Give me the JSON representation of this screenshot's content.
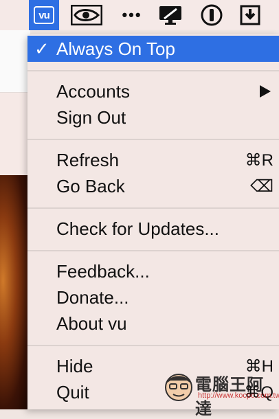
{
  "menubar": {
    "vu_label": "vu",
    "items": [
      "vu-app-icon",
      "nvidia-icon",
      "more-icon",
      "display-icon",
      "1password-icon",
      "download-icon"
    ]
  },
  "menu": {
    "always_on_top": {
      "label": "Always On Top",
      "checked": true,
      "check": "✓"
    },
    "accounts": {
      "label": "Accounts",
      "has_submenu": true
    },
    "sign_out": {
      "label": "Sign Out"
    },
    "refresh": {
      "label": "Refresh",
      "shortcut": "⌘R"
    },
    "go_back": {
      "label": "Go Back",
      "shortcut": "⌫"
    },
    "check_updates": {
      "label": "Check for Updates..."
    },
    "feedback": {
      "label": "Feedback..."
    },
    "donate": {
      "label": "Donate..."
    },
    "about": {
      "label": "About vu"
    },
    "hide": {
      "label": "Hide",
      "shortcut": "⌘H"
    },
    "quit": {
      "label": "Quit",
      "shortcut": "⌘Q"
    }
  },
  "watermark": {
    "title": "電腦王阿達",
    "url": "http://www.kocpc.com.tw"
  },
  "colors": {
    "highlight": "#2e6fe3",
    "menu_bg": "#f3e7e4",
    "menubar_bg": "#f5e9e7"
  }
}
